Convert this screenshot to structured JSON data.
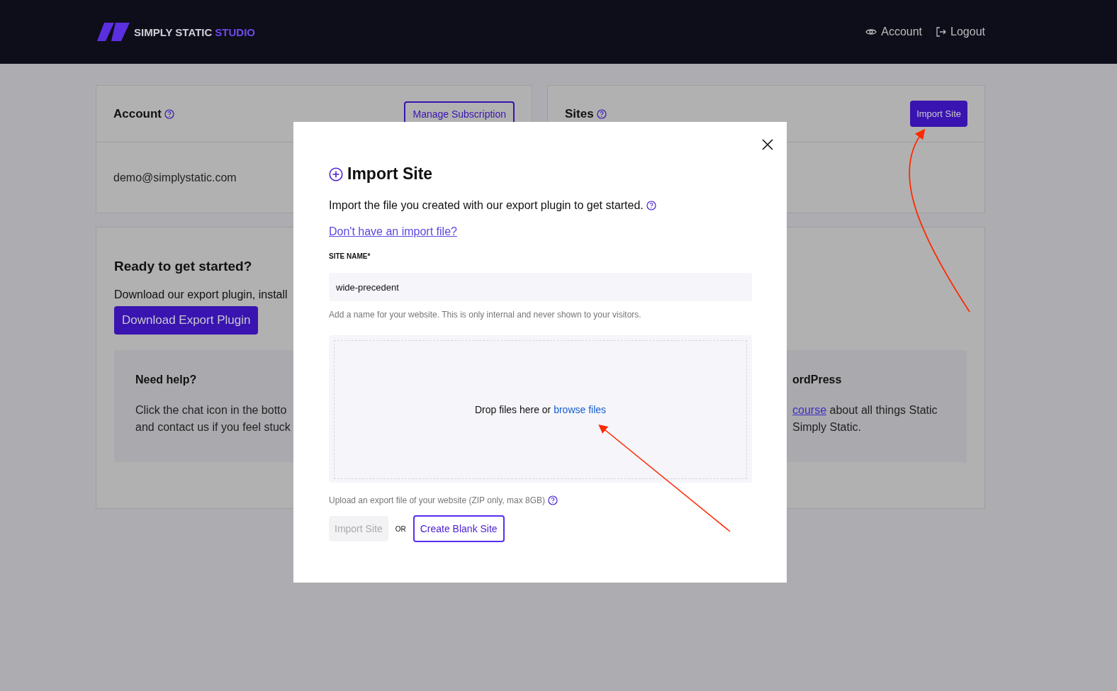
{
  "header": {
    "logo": {
      "brand": "SIMPLY STATIC",
      "product": "STUDIO"
    },
    "nav": [
      {
        "label": "Account"
      },
      {
        "label": "Logout"
      }
    ]
  },
  "account_card": {
    "title": "Account",
    "button": "Manage Subscription",
    "email": "demo@simplystatic.com"
  },
  "sites_card": {
    "title": "Sites",
    "button": "Import Site"
  },
  "start_card": {
    "title": "Ready to get started?",
    "text": "Download our export plugin, install",
    "button": "Download Export Plugin",
    "help": {
      "title": "Need help?",
      "lines": [
        "Click the chat icon in the botto",
        "and contact us if you feel stuck"
      ]
    },
    "learn": {
      "title": "ordPress",
      "link": "course",
      "lines": [
        "about all things Static",
        "Simply Static."
      ]
    }
  },
  "modal": {
    "title": "Import Site",
    "description": "Import the file you created with our export plugin to get started.",
    "link": "Don't have an import file?",
    "field_label": "SITE NAME*",
    "field_value": "wide-precedent",
    "field_hint": "Add a name for your website. This is only internal and never shown to your visitors.",
    "dropzone_text": "Drop files here or",
    "dropzone_link": "browse files",
    "upload_hint": "Upload an export file of your website (ZIP only, max 8GB)",
    "import_button": {
      "label": "Import Site",
      "disabled": true
    },
    "or": "OR",
    "blank_button": "Create Blank Site"
  }
}
